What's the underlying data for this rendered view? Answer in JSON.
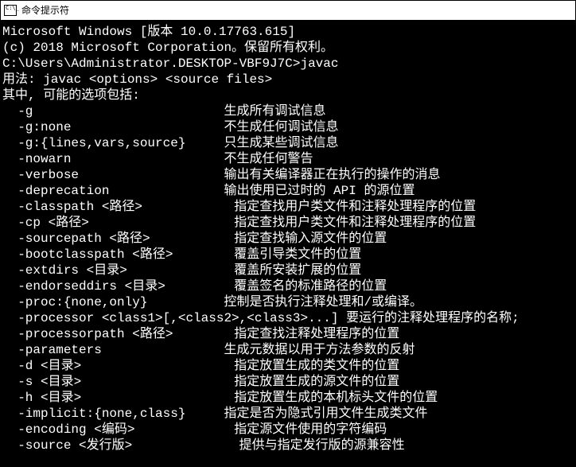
{
  "titlebar": {
    "title": "命令提示符"
  },
  "header": {
    "line1": "Microsoft Windows [版本 10.0.17763.615]",
    "line2": "(c) 2018 Microsoft Corporation。保留所有权利。",
    "blank1": "",
    "prompt": "C:\\Users\\Administrator.DESKTOP-VBF9J7C>javac",
    "usage": "用法: javac <options> <source files>",
    "where": "其中, 可能的选项包括:"
  },
  "options": [
    {
      "flag": "  -g                         ",
      "desc": "生成所有调试信息"
    },
    {
      "flag": "  -g:none                    ",
      "desc": "不生成任何调试信息"
    },
    {
      "flag": "  -g:{lines,vars,source}     ",
      "desc": "只生成某些调试信息"
    },
    {
      "flag": "  -nowarn                    ",
      "desc": "不生成任何警告"
    },
    {
      "flag": "  -verbose                   ",
      "desc": "输出有关编译器正在执行的操作的消息"
    },
    {
      "flag": "  -deprecation               ",
      "desc": "输出使用已过时的 API 的源位置"
    },
    {
      "flag": "  -classpath <路径>            ",
      "desc": "指定查找用户类文件和注释处理程序的位置"
    },
    {
      "flag": "  -cp <路径>                   ",
      "desc": "指定查找用户类文件和注释处理程序的位置"
    },
    {
      "flag": "  -sourcepath <路径>           ",
      "desc": "指定查找输入源文件的位置"
    },
    {
      "flag": "  -bootclasspath <路径>        ",
      "desc": "覆盖引导类文件的位置"
    },
    {
      "flag": "  -extdirs <目录>              ",
      "desc": "覆盖所安装扩展的位置"
    },
    {
      "flag": "  -endorseddirs <目录>         ",
      "desc": "覆盖签名的标准路径的位置"
    },
    {
      "flag": "  -proc:{none,only}          ",
      "desc": "控制是否执行注释处理和/或编译。"
    },
    {
      "flag": "  -processor <class1>[,<class2>,<class3>...] ",
      "desc": "要运行的注释处理程序的名称;"
    },
    {
      "flag": "  -processorpath <路径>        ",
      "desc": "指定查找注释处理程序的位置"
    },
    {
      "flag": "  -parameters                ",
      "desc": "生成元数据以用于方法参数的反射"
    },
    {
      "flag": "  -d <目录>                    ",
      "desc": "指定放置生成的类文件的位置"
    },
    {
      "flag": "  -s <目录>                    ",
      "desc": "指定放置生成的源文件的位置"
    },
    {
      "flag": "  -h <目录>                    ",
      "desc": "指定放置生成的本机标头文件的位置"
    },
    {
      "flag": "  -implicit:{none,class}     ",
      "desc": "指定是否为隐式引用文件生成类文件"
    },
    {
      "flag": "  -encoding <编码>             ",
      "desc": "指定源文件使用的字符编码"
    },
    {
      "flag": "  -source <发行版>              ",
      "desc": "提供与指定发行版的源兼容性"
    }
  ]
}
